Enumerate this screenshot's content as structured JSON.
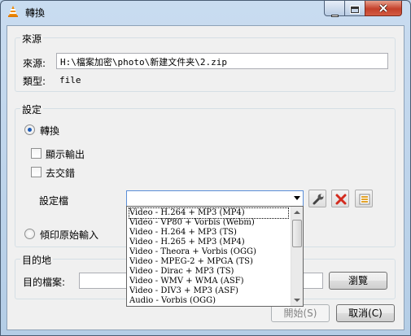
{
  "window": {
    "title": "轉換",
    "icon": "vlc-cone-icon",
    "controls": {
      "minimize": "minimize-icon",
      "maximize": "maximize-icon",
      "close": "close-icon"
    }
  },
  "source": {
    "group_label": "來源",
    "source_label": "來源:",
    "source_value": "H:\\檔案加密\\photo\\新建文件夹\\2.zip",
    "type_label": "類型:",
    "type_value": "file"
  },
  "settings": {
    "group_label": "設定",
    "convert_label": "轉換",
    "convert_selected": true,
    "display_output_label": "顯示輸出",
    "deinterlace_label": "去交錯",
    "profile_label": "設定檔",
    "profile_value": "",
    "dump_raw_label": "傾印原始輸入",
    "dump_raw_selected": false
  },
  "profile_dropdown": {
    "items": [
      "Video - H.264 + MP3 (MP4)",
      "Video - VP80 + Vorbis (Webm)",
      "Video - H.264 + MP3 (TS)",
      "Video - H.265 + MP3 (MP4)",
      "Video - Theora + Vorbis (OGG)",
      "Video - MPEG-2 + MPGA (TS)",
      "Video - Dirac + MP3 (TS)",
      "Video - WMV + WMA (ASF)",
      "Video - DIV3 + MP3 (ASF)",
      "Audio - Vorbis (OGG)"
    ],
    "selected_index": 0
  },
  "destination": {
    "group_label": "目的地",
    "file_label": "目的檔案:",
    "file_value": "",
    "browse_label": "瀏覽"
  },
  "footer": {
    "start_label": "開始(S)",
    "cancel_label": "取消(C)"
  },
  "tools": {
    "edit_icon": "wrench-icon",
    "delete_icon": "delete-x-icon",
    "new_icon": "new-profile-icon"
  },
  "colors": {
    "accent": "#1e5bb5",
    "close": "#c4402a",
    "delete": "#d32b1e"
  }
}
